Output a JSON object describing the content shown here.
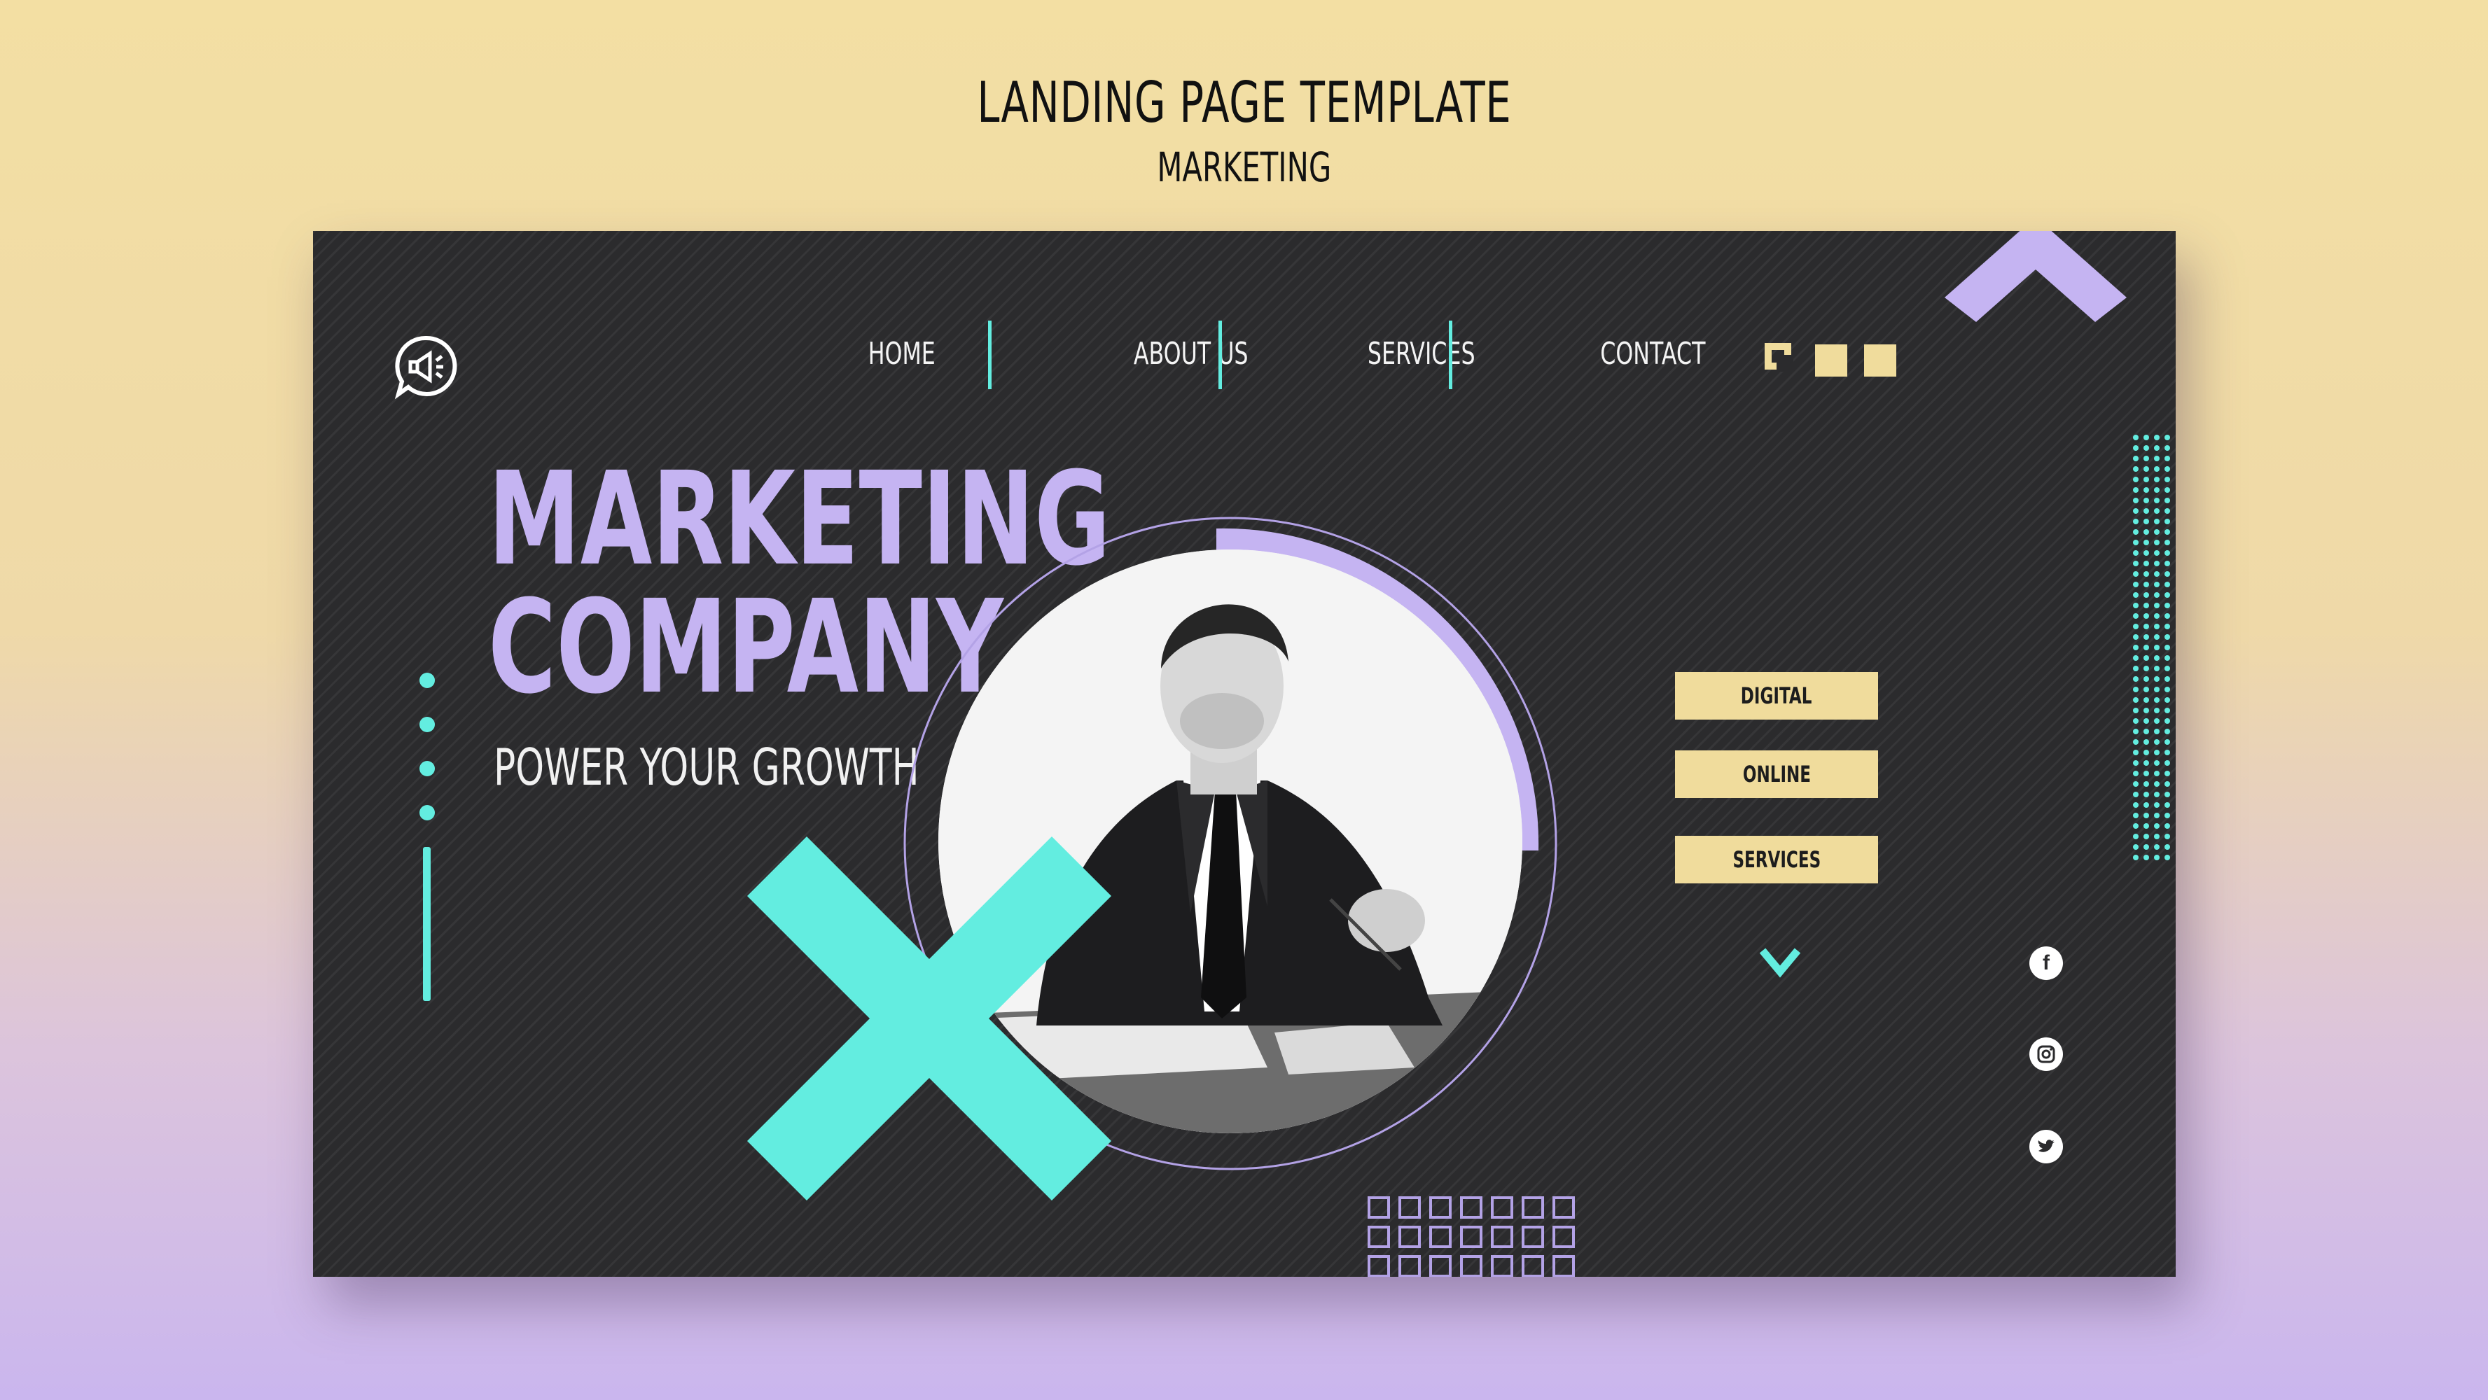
{
  "template": {
    "title": "LANDING PAGE TEMPLATE",
    "subtitle": "MARKETING"
  },
  "nav": {
    "items": [
      {
        "label": "HOME"
      },
      {
        "label": "ABOUT US"
      },
      {
        "label": "SERVICES"
      },
      {
        "label": "CONTACT"
      }
    ]
  },
  "hero": {
    "headline_line1": "MARKETING",
    "headline_line2": "COMPANY",
    "tagline": "POWER YOUR GROWTH"
  },
  "tags": [
    {
      "label": "DIGITAL"
    },
    {
      "label": "ONLINE"
    },
    {
      "label": "SERVICES"
    }
  ],
  "icons": {
    "logo": "megaphone-chat-icon",
    "social": [
      "facebook-icon",
      "instagram-icon",
      "twitter-icon"
    ],
    "scroll": "chevron-down-icon"
  },
  "colors": {
    "background_top": "#f3dfa3",
    "background_bottom": "#cab6ee",
    "card": "#2b2b2d",
    "lavender": "#c5b4f2",
    "teal": "#63ede0",
    "sand": "#f0dc9c"
  }
}
